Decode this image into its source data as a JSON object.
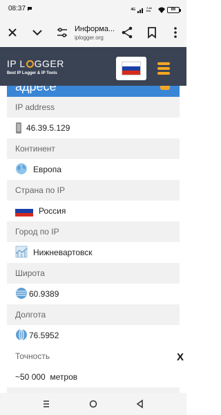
{
  "status_bar": {
    "time": "08:37",
    "network": "4G",
    "speed": "7.44 K/s",
    "battery": "86"
  },
  "browser": {
    "title": "Информа...",
    "domain": "iplogger.org",
    "icons": [
      "close-icon",
      "chevron-down-icon",
      "site-settings-icon",
      "share-icon",
      "bookmark-icon",
      "more-vert-icon"
    ]
  },
  "site_header": {
    "logo_text_left": "IP L",
    "logo_text_right": "GGER",
    "tagline": "Best IP Logger & IP Tools",
    "accent": "#f5a623",
    "header_bg": "#3a4354"
  },
  "card": {
    "heading_partial": "адресе",
    "heading_bg": "#3a86d6",
    "rows": [
      {
        "label": "IP address",
        "value": "46.39.5.129",
        "icon": "phone-icon"
      },
      {
        "label": "Континент",
        "value": "Европа",
        "icon": "globe-icon"
      },
      {
        "label": "Страна по IP",
        "value": "Россия",
        "icon": "russia-flag-icon"
      },
      {
        "label": "Город по IP",
        "value": "Нижневартовск",
        "icon": "city-map-icon"
      },
      {
        "label": "Широта",
        "value": "60.9389",
        "icon": "latitude-globe-icon"
      },
      {
        "label": "Долгота",
        "value": "76.5952",
        "icon": "longitude-globe-icon"
      },
      {
        "label": "Точность",
        "value": "~50 000  метров"
      }
    ]
  },
  "side_close": "X",
  "nav_bar": {
    "icons": [
      "recent-apps-icon",
      "home-icon",
      "back-icon"
    ]
  }
}
